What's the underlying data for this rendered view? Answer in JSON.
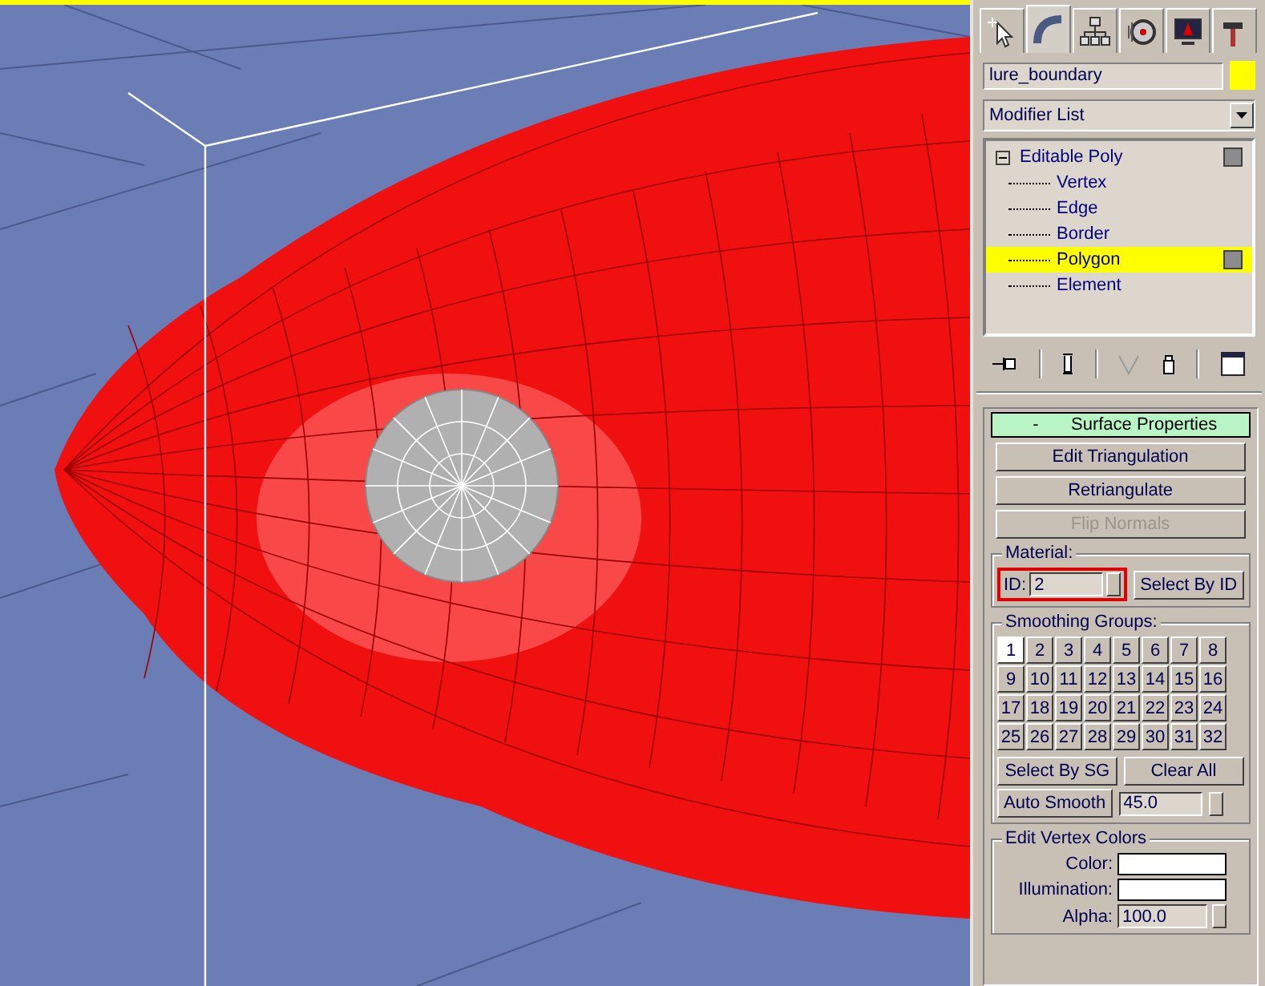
{
  "viewport": {
    "active": true
  },
  "command_panel": {
    "tabs": [
      {
        "kind": "create",
        "selected": false
      },
      {
        "kind": "modify",
        "selected": true
      },
      {
        "kind": "hierarchy",
        "selected": false
      },
      {
        "kind": "motion",
        "selected": false
      },
      {
        "kind": "display",
        "selected": false
      },
      {
        "kind": "utilities",
        "selected": false
      }
    ],
    "object": {
      "name": "lure_boundary",
      "color": "#ffff00"
    },
    "modifier_list": "Modifier List",
    "stack": [
      {
        "label": "Editable Poly",
        "expanded": true,
        "selected": false,
        "children": [
          {
            "label": "Vertex",
            "selected": false
          },
          {
            "label": "Edge",
            "selected": false
          },
          {
            "label": "Border",
            "selected": false
          },
          {
            "label": "Polygon",
            "selected": true
          },
          {
            "label": "Element",
            "selected": false
          }
        ]
      }
    ],
    "rollout": {
      "title": "Surface Properties",
      "toggle": "-",
      "expanded": true,
      "buttons": [
        {
          "label": "Edit Triangulation",
          "disabled": false
        },
        {
          "label": "Retriangulate",
          "disabled": false
        },
        {
          "label": "Flip Normals",
          "disabled": true
        }
      ],
      "material": {
        "label": "Material:",
        "id_label": "ID:",
        "id_value": "2",
        "highlighted": true,
        "select_button": "Select By ID"
      },
      "smoothing": {
        "label": "Smoothing Groups:",
        "groups": [
          {
            "label": "1",
            "selected": true
          },
          {
            "label": "2",
            "selected": false
          },
          {
            "label": "3",
            "selected": false
          },
          {
            "label": "4",
            "selected": false
          },
          {
            "label": "5",
            "selected": false
          },
          {
            "label": "6",
            "selected": false
          },
          {
            "label": "7",
            "selected": false
          },
          {
            "label": "8",
            "selected": false
          },
          {
            "label": "9",
            "selected": false
          },
          {
            "label": "10",
            "selected": false
          },
          {
            "label": "11",
            "selected": false
          },
          {
            "label": "12",
            "selected": false
          },
          {
            "label": "13",
            "selected": false
          },
          {
            "label": "14",
            "selected": false
          },
          {
            "label": "15",
            "selected": false
          },
          {
            "label": "16",
            "selected": false
          },
          {
            "label": "17",
            "selected": false
          },
          {
            "label": "18",
            "selected": false
          },
          {
            "label": "19",
            "selected": false
          },
          {
            "label": "20",
            "selected": false
          },
          {
            "label": "21",
            "selected": false
          },
          {
            "label": "22",
            "selected": false
          },
          {
            "label": "23",
            "selected": false
          },
          {
            "label": "24",
            "selected": false
          },
          {
            "label": "25",
            "selected": false
          },
          {
            "label": "26",
            "selected": false
          },
          {
            "label": "27",
            "selected": false
          },
          {
            "label": "28",
            "selected": false
          },
          {
            "label": "29",
            "selected": false
          },
          {
            "label": "30",
            "selected": false
          },
          {
            "label": "31",
            "selected": false
          },
          {
            "label": "32",
            "selected": false
          }
        ],
        "select_button": "Select By SG",
        "clear_button": "Clear All",
        "auto_smooth_button": "Auto Smooth",
        "threshold": "45.0"
      },
      "vertex_colors": {
        "label": "Edit Vertex Colors",
        "rows": [
          {
            "kind": "swatch",
            "label": "Color:",
            "color": "#ffffff"
          },
          {
            "kind": "swatch",
            "label": "Illumination:",
            "color": "#ffffff"
          },
          {
            "kind": "spinner",
            "label": "Alpha:",
            "value": "100.0"
          }
        ]
      }
    }
  }
}
